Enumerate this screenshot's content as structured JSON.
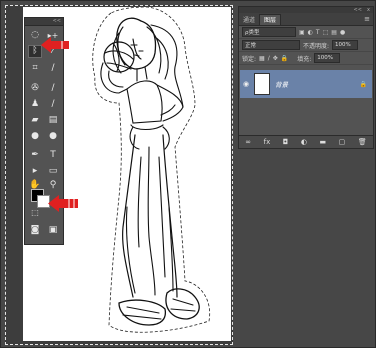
{
  "layers_panel": {
    "tab_channels": "通道",
    "tab_layers": "图层",
    "kind_label": "ρ类型",
    "blend_mode": "正常",
    "opacity_label": "不透明度:",
    "opacity_value": "100%",
    "lock_label": "锁定:",
    "fill_label": "填充:",
    "fill_value": "100%",
    "layer_name": "背景"
  },
  "toolbar": {
    "collapse_glyph": "<<",
    "tools": [
      "marquee",
      "move",
      "lasso",
      "magic-wand",
      "crop",
      "eyedropper",
      "spot-heal",
      "brush",
      "clone-stamp",
      "history-brush",
      "eraser",
      "gradient",
      "blur",
      "dodge",
      "pen",
      "type",
      "path-select",
      "shape",
      "hand",
      "zoom"
    ]
  },
  "panel_header_glyphs": {
    "collapse": "<<",
    "close": "x",
    "menu": "≡"
  },
  "colors": {
    "foreground": "#000000",
    "background": "#ffffff",
    "selected_layer": "#6a82a8",
    "annotation_arrow": "#e02020"
  }
}
